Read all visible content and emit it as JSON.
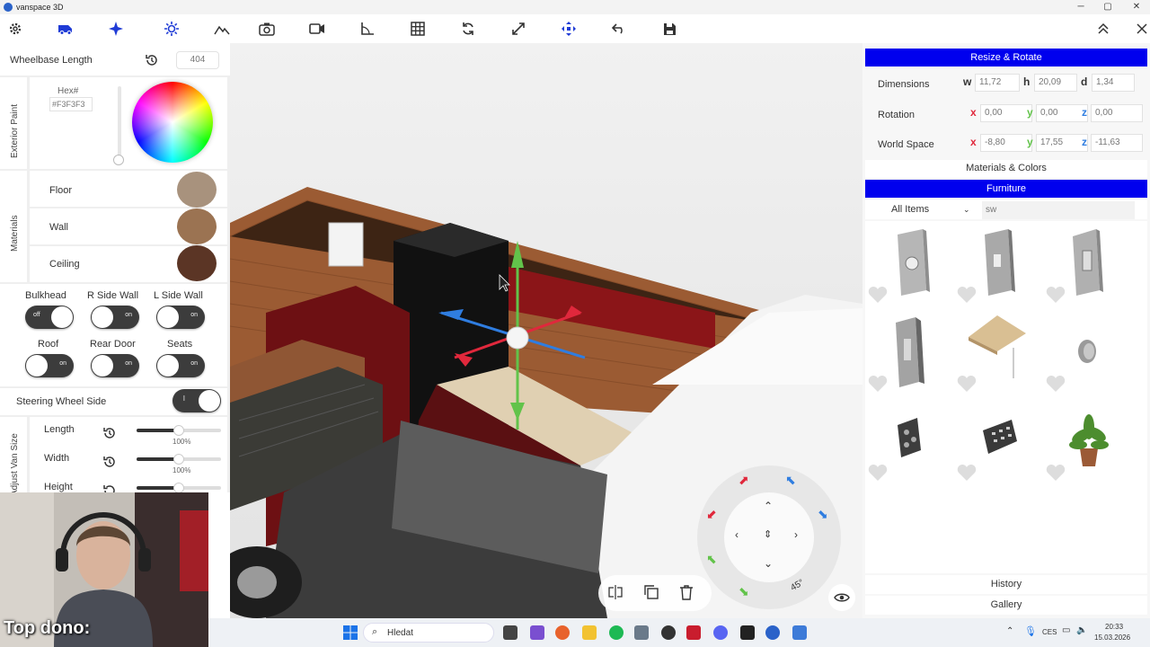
{
  "titlebar": {
    "title": "vanspace 3D",
    "min": "─",
    "max": "▢",
    "close": "✕"
  },
  "left": {
    "wheelbase": {
      "label": "Wheelbase Length",
      "value": "404"
    },
    "exterior": {
      "section": "Exterior Paint",
      "hex_label": "Hex#",
      "hex_value": "#F3F3F3"
    },
    "materials": {
      "section": "Materials",
      "items": [
        {
          "label": "Floor",
          "color": "#a8927d"
        },
        {
          "label": "Wall",
          "color": "#9b7352"
        },
        {
          "label": "Ceiling",
          "color": "#5b3525"
        }
      ]
    },
    "toggles": [
      {
        "label": "Bulkhead",
        "state": "off"
      },
      {
        "label": "R Side Wall",
        "state": "on"
      },
      {
        "label": "L Side Wall",
        "state": "on"
      },
      {
        "label": "Roof",
        "state": "on"
      },
      {
        "label": "Rear Door",
        "state": "on"
      },
      {
        "label": "Seats",
        "state": "on"
      }
    ],
    "steering": {
      "label": "Steering Wheel Side",
      "value": "l"
    },
    "size": {
      "section": "Adjust Van Size",
      "rows": [
        {
          "label": "Length",
          "pct": "100%",
          "value": 0.5
        },
        {
          "label": "Width",
          "pct": "100%",
          "value": 0.5
        },
        {
          "label": "Height",
          "pct": "",
          "value": 0.5
        }
      ]
    }
  },
  "right": {
    "resize_header": "Resize & Rotate",
    "dimensions": {
      "label": "Dimensions",
      "w_label": "w",
      "w": "11,72",
      "h_label": "h",
      "h": "20,09",
      "d_label": "d",
      "d": "1,34"
    },
    "rotation": {
      "label": "Rotation",
      "x_label": "x",
      "x": "0,00",
      "y_label": "y",
      "y": "0,00",
      "z_label": "z",
      "z": "0,00"
    },
    "world": {
      "label": "World Space",
      "x_label": "x",
      "x": "-8,80",
      "y_label": "y",
      "y": "17,55",
      "z_label": "z",
      "z": "-11,63"
    },
    "materials_colors": "Materials & Colors",
    "furniture_header": "Furniture",
    "filter": "All Items",
    "search": "sw",
    "history": "History",
    "gallery": "Gallery"
  },
  "viewport": {
    "rotate_step": "45°"
  },
  "stream": {
    "overlay": "Top dono:"
  },
  "taskbar": {
    "search": "Hledat",
    "lang": "CES",
    "time": "20:33",
    "date": "15.03.2026"
  },
  "colors": {
    "accent": "#0000ee",
    "axis_x": "#e0283c",
    "axis_y": "#62c34a",
    "axis_z": "#2f7de0"
  }
}
